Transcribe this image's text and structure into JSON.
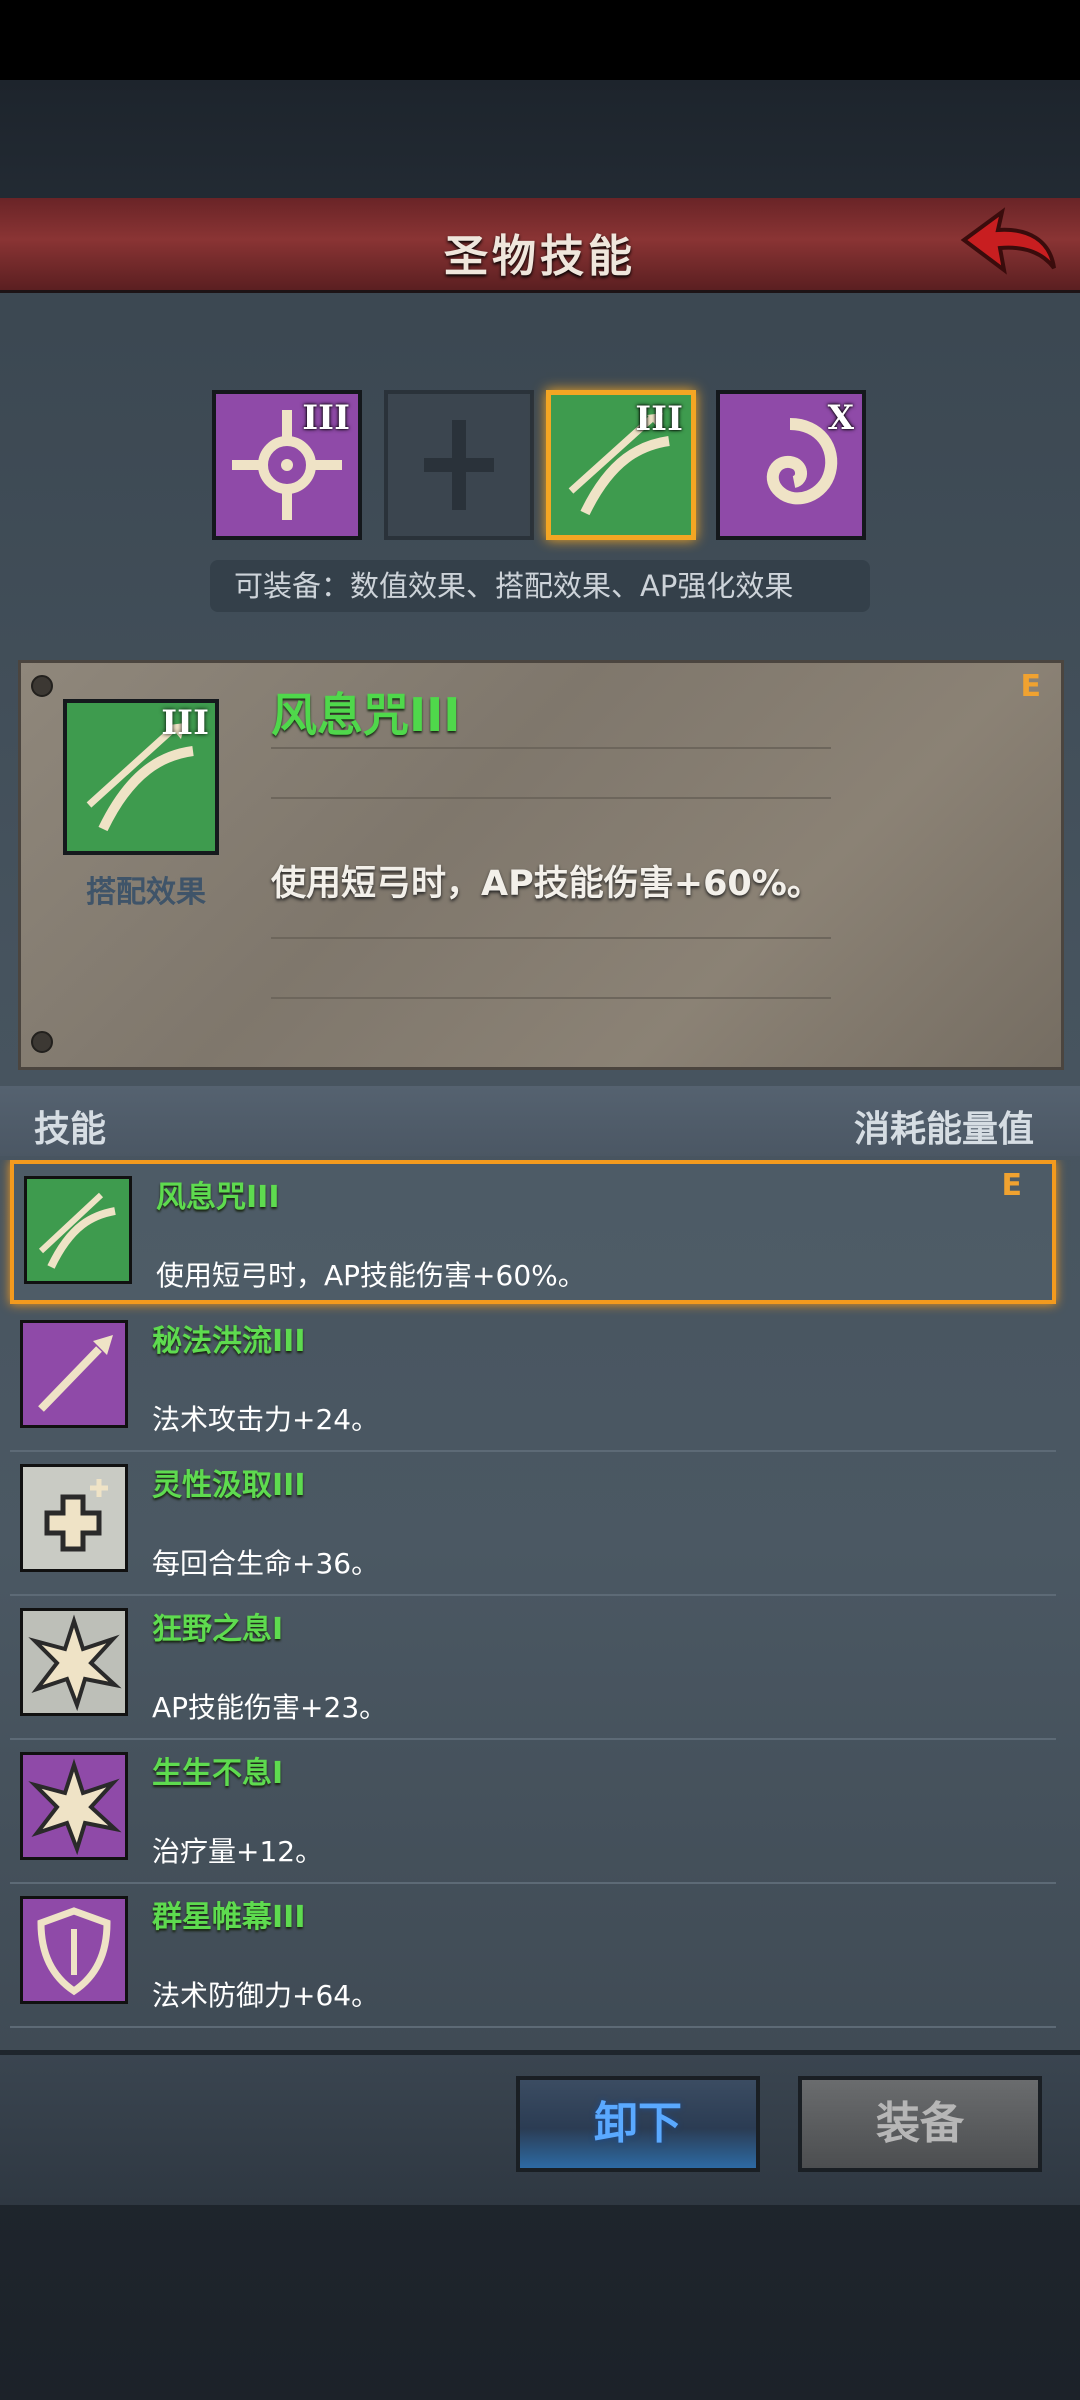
{
  "header": {
    "title": "圣物技能",
    "back_icon": "back-arrow-icon"
  },
  "slots": [
    {
      "icon": "crosshair-icon",
      "tier": "III",
      "color": "#8f4aa8"
    },
    {
      "icon": "empty-slot-cross-icon",
      "tier": "",
      "color": "#3b454f"
    },
    {
      "icon": "bow-arrow-icon",
      "tier": "III",
      "color": "#3e9b4e",
      "selected": true
    },
    {
      "icon": "swirl-icon",
      "tier": "X",
      "color": "#8f4aa8"
    }
  ],
  "equip_hint": "可装备：数值效果、搭配效果、AP强化效果",
  "detail": {
    "name": "风息咒III",
    "grade": "E",
    "subtitle": "搭配效果",
    "description": "使用短弓时，AP技能伤害+60%。",
    "tier": "III"
  },
  "list_header": {
    "left": "技能",
    "right": "消耗能量值"
  },
  "skills": [
    {
      "name": "风息咒III",
      "description": "使用短弓时，AP技能伤害+60%。",
      "grade": "E",
      "icon": "bow-arrow-icon",
      "color": "#3e9b4e",
      "selected": true
    },
    {
      "name": "秘法洪流III",
      "description": "法术攻击力+24。",
      "grade": "",
      "icon": "spear-icon",
      "color": "#8f4aa8"
    },
    {
      "name": "灵性汲取III",
      "description": "每回合生命+36。",
      "grade": "",
      "icon": "heal-cross-icon",
      "color": "#c9cbc4"
    },
    {
      "name": "狂野之息I",
      "description": "AP技能伤害+23。",
      "grade": "",
      "icon": "burst-icon",
      "color": "#bdbfb8"
    },
    {
      "name": "生生不息I",
      "description": "治疗量+12。",
      "grade": "",
      "icon": "burst-icon",
      "color": "#8f4aa8"
    },
    {
      "name": "群星帷幕III",
      "description": "法术防御力+64。",
      "grade": "",
      "icon": "shield-icon",
      "color": "#8f4aa8"
    }
  ],
  "buttons": {
    "unequip": "卸下",
    "equip": "装备"
  }
}
